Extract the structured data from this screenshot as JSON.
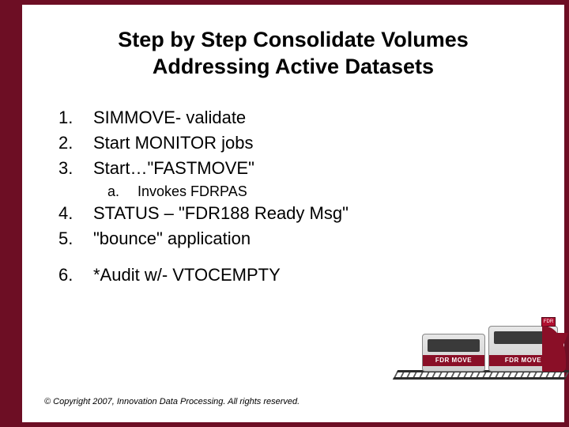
{
  "title_line1": "Step by Step Consolidate Volumes",
  "title_line2": "Addressing Active Datasets",
  "items": {
    "i1": {
      "num": "1.",
      "text": "SIMMOVE- validate"
    },
    "i2": {
      "num": "2.",
      "text": "Start MONITOR jobs"
    },
    "i3": {
      "num": "3.",
      "text": "Start…\"FASTMOVE\""
    },
    "i3a": {
      "num": "a.",
      "text": "Invokes FDRPAS"
    },
    "i4": {
      "num": "4.",
      "text": "STATUS – \"FDR188 Ready Msg\""
    },
    "i5": {
      "num": "5.",
      "text": "\"bounce\" application"
    },
    "i6": {
      "num": "6.",
      "text": "*Audit w/- VTOCEMPTY"
    }
  },
  "train": {
    "label": "FDR MOVE",
    "badge": "FDR"
  },
  "copyright": "© Copyright 2007, Innovation Data Processing. All rights reserved."
}
